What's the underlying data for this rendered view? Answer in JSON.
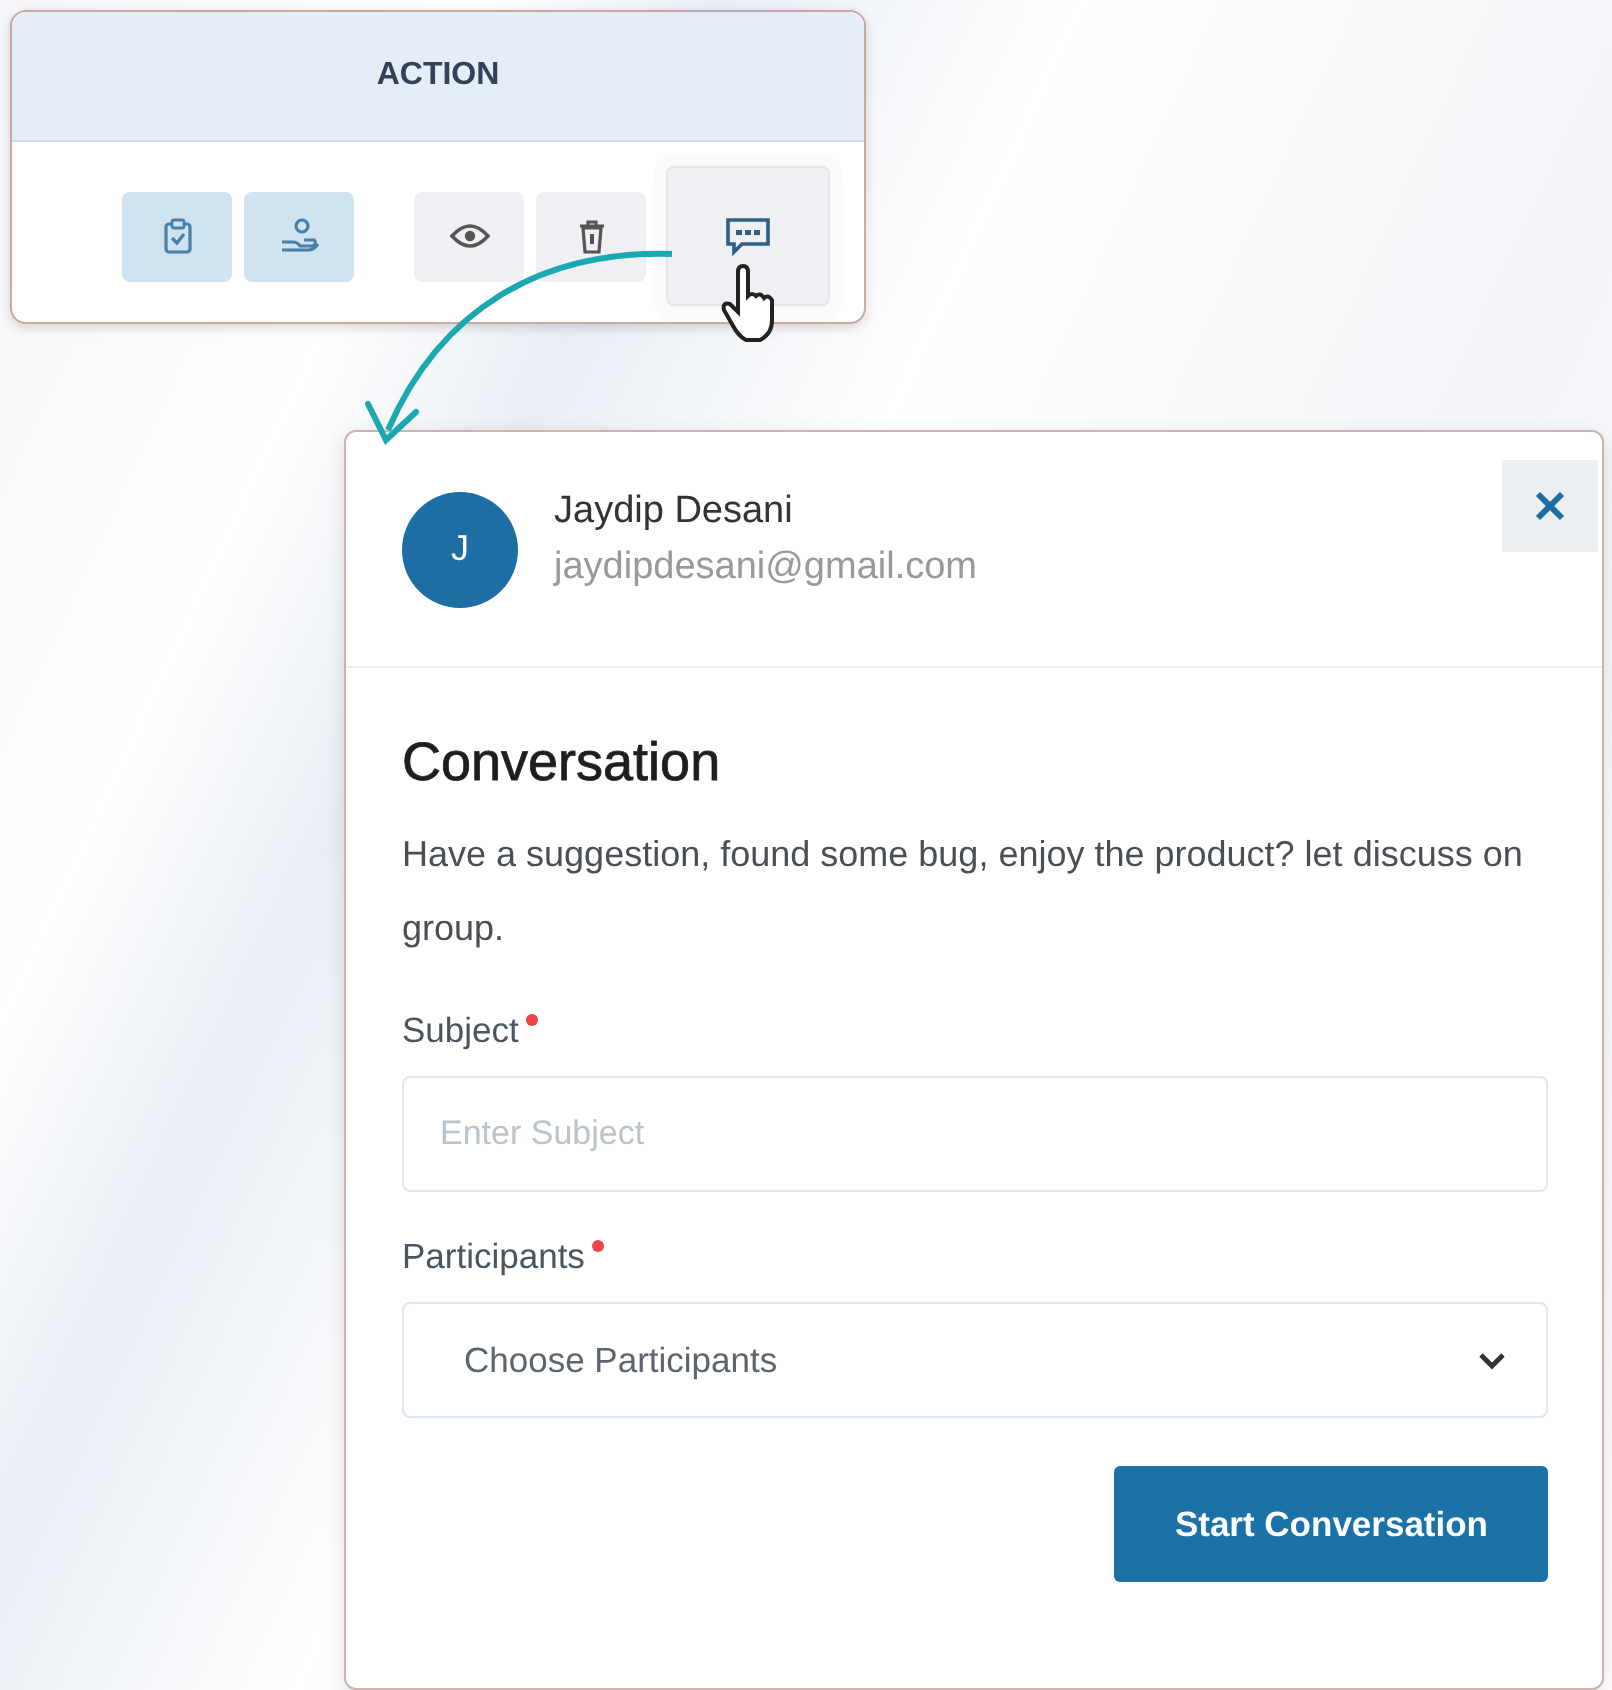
{
  "action_panel": {
    "header": "ACTION",
    "buttons": [
      {
        "kind": "checklist",
        "highlighted": false
      },
      {
        "kind": "hand",
        "highlighted": false
      },
      {
        "kind": "view",
        "highlighted": false
      },
      {
        "kind": "delete",
        "highlighted": false
      },
      {
        "kind": "chat",
        "highlighted": true
      }
    ]
  },
  "dialog": {
    "user": {
      "initial": "J",
      "name": "Jaydip Desani",
      "email": "jaydipdesani@gmail.com"
    },
    "title": "Conversation",
    "description": "Have a suggestion, found some bug, enjoy the product? let discuss on group.",
    "fields": [
      {
        "kind": "text",
        "label": "Subject",
        "required": true,
        "placeholder": "Enter Subject"
      },
      {
        "kind": "select",
        "label": "Participants",
        "required": true,
        "placeholder": "Choose Participants"
      }
    ],
    "submit": "Start Conversation"
  }
}
